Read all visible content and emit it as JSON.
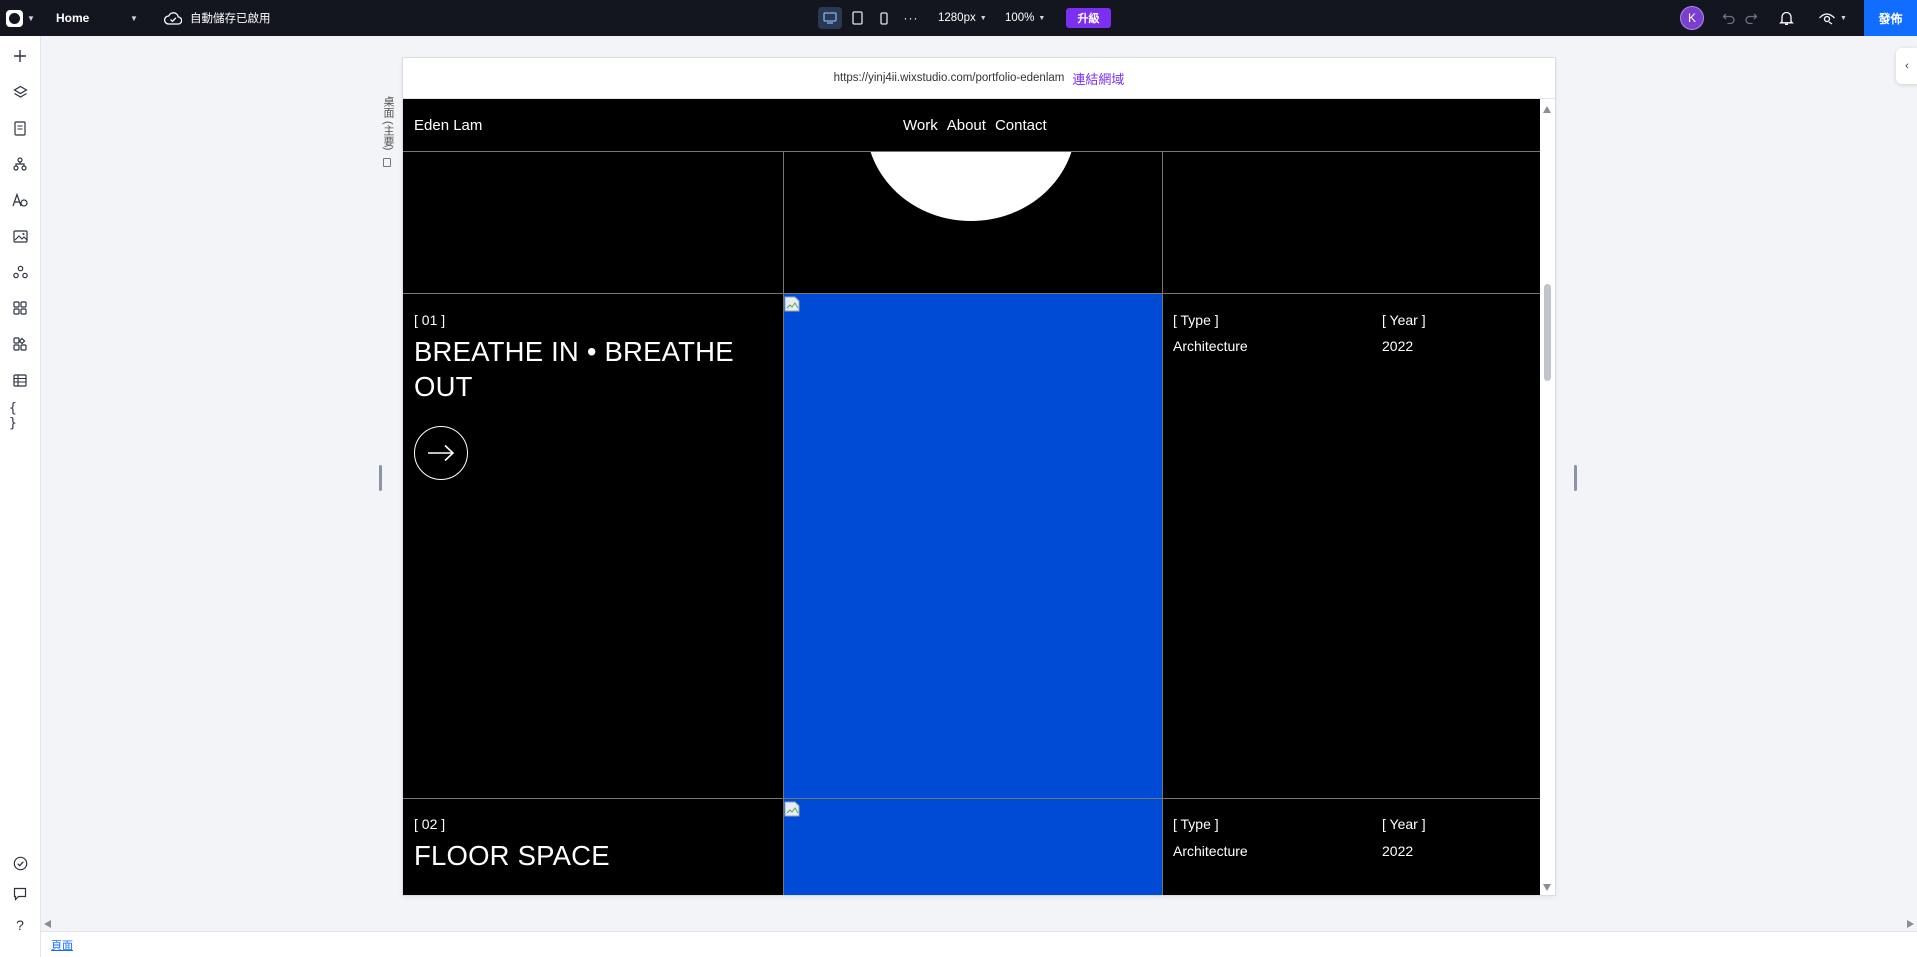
{
  "topbar": {
    "page_name": "Home",
    "autosave_text": "自動儲存已啟用",
    "width_value": "1280px",
    "zoom_value": "100%",
    "upgrade_label": "升級",
    "avatar_initial": "K",
    "publish_label": "發佈"
  },
  "left_toolbar": {
    "icons": [
      "add-icon",
      "layers-icon",
      "pages-icon",
      "sitemap-icon",
      "text-theme-icon",
      "media-icon",
      "apps-icon",
      "app-market-icon",
      "components-icon",
      "cms-table-icon",
      "code-icon",
      "site-checker-icon",
      "comments-icon",
      "help-icon"
    ]
  },
  "canvas": {
    "url": "https://yinj4ii.wixstudio.com/portfolio-edenlam",
    "connect_domain": "連結網域",
    "vertical_label": "桌面 (主要)"
  },
  "site": {
    "brand": "Eden Lam",
    "nav": [
      "Work",
      "About",
      "Contact"
    ],
    "projects": [
      {
        "index": "[ 01 ]",
        "title": "BREATHE IN • BREATHE OUT",
        "type_label": "[ Type ]",
        "year_label": "[ Year ]",
        "type": "Architecture",
        "year": "2022"
      },
      {
        "index": "[ 02 ]",
        "title": "FLOOR SPACE",
        "type_label": "[ Type ]",
        "year_label": "[ Year ]",
        "type": "Architecture",
        "year": "2022"
      }
    ],
    "accent_blue": "#004bd6"
  },
  "statusbar": {
    "page_link": "頁面"
  }
}
